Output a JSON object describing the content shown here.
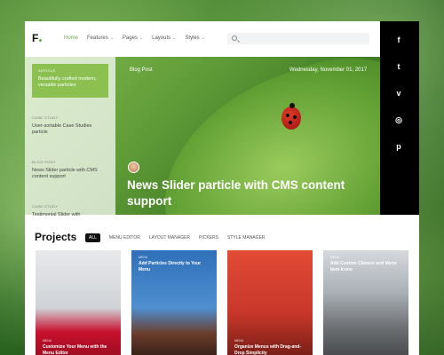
{
  "header": {
    "logo": "F",
    "nav": [
      {
        "label": "Home",
        "active": true,
        "dropdown": false
      },
      {
        "label": "Features",
        "active": false,
        "dropdown": true
      },
      {
        "label": "Pages",
        "active": false,
        "dropdown": true
      },
      {
        "label": "Layouts",
        "active": false,
        "dropdown": true
      },
      {
        "label": "Styles",
        "active": false,
        "dropdown": true
      }
    ],
    "search_icon": "search-icon"
  },
  "social": [
    {
      "icon": "facebook-icon",
      "glyph": "f"
    },
    {
      "icon": "twitter-icon",
      "glyph": "t"
    },
    {
      "icon": "vimeo-icon",
      "glyph": "v"
    },
    {
      "icon": "instagram-icon",
      "glyph": "◎"
    },
    {
      "icon": "pinterest-icon",
      "glyph": "p"
    }
  ],
  "sidebar": {
    "items": [
      {
        "category": "ARTICLE",
        "title": "Beautifully crafted modern, versatile particles",
        "active": true
      },
      {
        "category": "CASE STUDY",
        "title": "User-sortable Case Studies particle",
        "active": false
      },
      {
        "category": "BLOG POST",
        "title": "News Slider particle with CMS content support",
        "active": false
      },
      {
        "category": "CASE STUDY",
        "title": "Testimonial Slider with",
        "active": false
      }
    ]
  },
  "hero": {
    "label": "Blog Post",
    "date": "Wednesday, November 01, 2017",
    "title": "News Slider particle with CMS content support"
  },
  "projects": {
    "title": "Projects",
    "filters": [
      "ALL",
      "MENU EDITOR",
      "LAYOUT MANAGER",
      "PICKERS",
      "STYLE MANAGER"
    ],
    "active_filter": "ALL",
    "cards": [
      {
        "caption": "Customize Your Menu with the Menu Editor",
        "tag": "MENU",
        "color": "#d9dadc"
      },
      {
        "caption": "Add Particles Directly to Your Menu",
        "tag": "MENU",
        "color": "#3b78c4"
      },
      {
        "caption": "Organize Menus with Drag-and-Drop Simplicity",
        "tag": "MENU",
        "color": "#d8402e"
      },
      {
        "caption": "Add Custom Classes and Menu Item Icons",
        "tag": "MENU",
        "color": "#9aa0a6"
      }
    ]
  },
  "colors": {
    "accent": "#8cc152",
    "dark": "#000000"
  }
}
